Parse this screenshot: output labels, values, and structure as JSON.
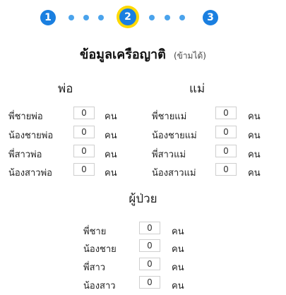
{
  "stepper": {
    "steps": [
      "1",
      "2",
      "3"
    ],
    "active_step": "2"
  },
  "section": {
    "title": "ข้อมูลเครือญาติ",
    "skip_label": "(ข้ามได้)"
  },
  "father": {
    "heading": "พ่อ",
    "rows": [
      {
        "label": "พี่ชายพ่อ",
        "value": "0",
        "unit": "คน"
      },
      {
        "label": "น้องชายพ่อ",
        "value": "0",
        "unit": "คน"
      },
      {
        "label": "พี่สาวพ่อ",
        "value": "0",
        "unit": "คน"
      },
      {
        "label": "น้องสาวพ่อ",
        "value": "0",
        "unit": "คน"
      }
    ]
  },
  "mother": {
    "heading": "แม่",
    "rows": [
      {
        "label": "พี่ชายแม่",
        "value": "0",
        "unit": "คน"
      },
      {
        "label": "น้องชายแม่",
        "value": "0",
        "unit": "คน"
      },
      {
        "label": "พี่สาวแม่",
        "value": "0",
        "unit": "คน"
      },
      {
        "label": "น้องสาวแม่",
        "value": "0",
        "unit": "คน"
      }
    ]
  },
  "patient": {
    "heading": "ผู้ป่วย",
    "rows": [
      {
        "label": "พี่ชาย",
        "value": "0",
        "unit": "คน"
      },
      {
        "label": "น้องชาย",
        "value": "0",
        "unit": "คน"
      },
      {
        "label": "พี่สาว",
        "value": "0",
        "unit": "คน"
      },
      {
        "label": "น้องสาว",
        "value": "0",
        "unit": "คน"
      }
    ]
  }
}
